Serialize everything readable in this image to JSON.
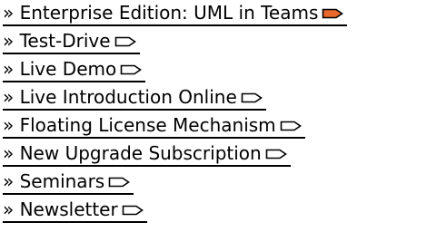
{
  "colors": {
    "text": "#000000",
    "underline": "#000000",
    "active_arrow_fill": "#e8682c",
    "inactive_arrow_fill": "#ffffff",
    "arrow_stroke": "#000000"
  },
  "menu": {
    "items": [
      {
        "label": "» Enterprise Edition: UML in Teams",
        "icon": "arrow-right-icon",
        "active": true
      },
      {
        "label": "» Test-Drive",
        "icon": "arrow-right-icon",
        "active": false
      },
      {
        "label": "» Live Demo",
        "icon": "arrow-right-icon",
        "active": false
      },
      {
        "label": "» Live Introduction Online",
        "icon": "arrow-right-icon",
        "active": false
      },
      {
        "label": "» Floating License Mechanism",
        "icon": "arrow-right-icon",
        "active": false
      },
      {
        "label": "» New Upgrade Subscription",
        "icon": "arrow-right-icon",
        "active": false
      },
      {
        "label": "» Seminars",
        "icon": "arrow-right-icon",
        "active": false
      },
      {
        "label": "» Newsletter",
        "icon": "arrow-right-icon",
        "active": false
      }
    ]
  }
}
